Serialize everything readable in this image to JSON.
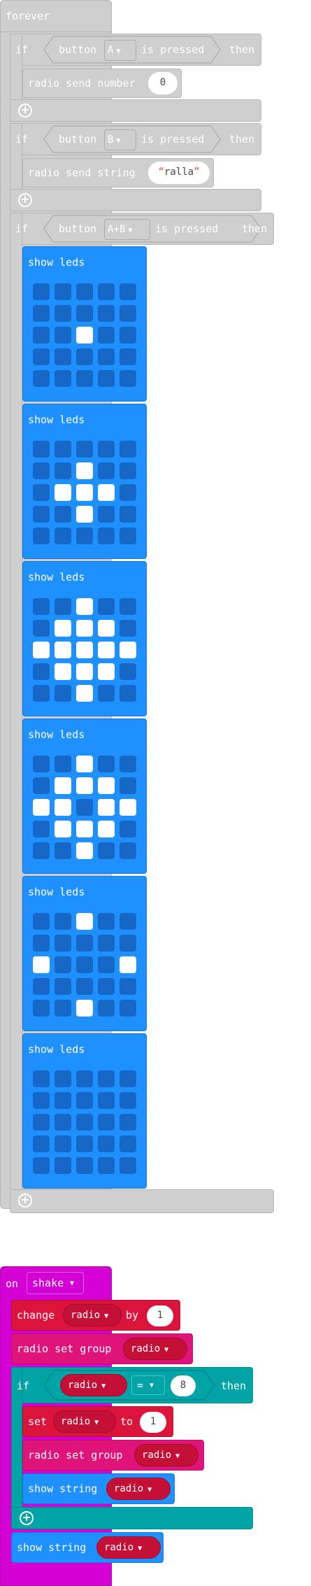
{
  "forever": {
    "label": "forever",
    "blocks": [
      {
        "if_label": "if",
        "button_label": "button",
        "button": "A",
        "is_pressed": "is pressed",
        "then": "then",
        "statement": "radio send number",
        "value": "0"
      },
      {
        "if_label": "if",
        "button_label": "button",
        "button": "B",
        "is_pressed": "is pressed",
        "then": "then",
        "statement": "radio send string",
        "value": "ralla"
      },
      {
        "if_label": "if",
        "button_label": "button",
        "button": "A+B",
        "is_pressed": "is pressed",
        "then": "then"
      }
    ],
    "show_leds_label": "show leds",
    "led_frames": [
      [
        [
          0,
          0,
          0,
          0,
          0
        ],
        [
          0,
          0,
          0,
          0,
          0
        ],
        [
          0,
          0,
          1,
          0,
          0
        ],
        [
          0,
          0,
          0,
          0,
          0
        ],
        [
          0,
          0,
          0,
          0,
          0
        ]
      ],
      [
        [
          0,
          0,
          0,
          0,
          0
        ],
        [
          0,
          0,
          1,
          0,
          0
        ],
        [
          0,
          1,
          1,
          1,
          0
        ],
        [
          0,
          0,
          1,
          0,
          0
        ],
        [
          0,
          0,
          0,
          0,
          0
        ]
      ],
      [
        [
          0,
          0,
          1,
          0,
          0
        ],
        [
          0,
          1,
          1,
          1,
          0
        ],
        [
          1,
          1,
          1,
          1,
          1
        ],
        [
          0,
          1,
          1,
          1,
          0
        ],
        [
          0,
          0,
          1,
          0,
          0
        ]
      ],
      [
        [
          0,
          0,
          1,
          0,
          0
        ],
        [
          0,
          1,
          1,
          1,
          0
        ],
        [
          1,
          1,
          0,
          1,
          1
        ],
        [
          0,
          1,
          1,
          1,
          0
        ],
        [
          0,
          0,
          1,
          0,
          0
        ]
      ],
      [
        [
          0,
          0,
          1,
          0,
          0
        ],
        [
          0,
          0,
          0,
          0,
          0
        ],
        [
          1,
          0,
          0,
          0,
          1
        ],
        [
          0,
          0,
          0,
          0,
          0
        ],
        [
          0,
          0,
          1,
          0,
          0
        ]
      ],
      [
        [
          0,
          0,
          0,
          0,
          0
        ],
        [
          0,
          0,
          0,
          0,
          0
        ],
        [
          0,
          0,
          0,
          0,
          0
        ],
        [
          0,
          0,
          0,
          0,
          0
        ],
        [
          0,
          0,
          0,
          0,
          0
        ]
      ]
    ]
  },
  "on_shake": {
    "on_label": "on",
    "event": "shake",
    "change_label": "change",
    "change_var": "radio",
    "by_label": "by",
    "change_value": "1",
    "set_group_label": "radio set group",
    "set_group_var": "radio",
    "if_label": "if",
    "cond_var": "radio",
    "cond_op": "=",
    "cond_value": "8",
    "then_label": "then",
    "set_label": "set",
    "set_var": "radio",
    "to_label": "to",
    "set_value": "1",
    "inner_group_label": "radio set group",
    "inner_group_var": "radio",
    "show_string_label": "show string",
    "show_string_var": "radio",
    "outer_show_string_label": "show string",
    "outer_show_string_var": "radio"
  },
  "colors": {
    "loops": "#cfcfcf",
    "led": "#1e90ff",
    "input": "#d400d4",
    "variables": "#dc143c",
    "radio": "#e0137a",
    "logic": "#00a4a6"
  }
}
